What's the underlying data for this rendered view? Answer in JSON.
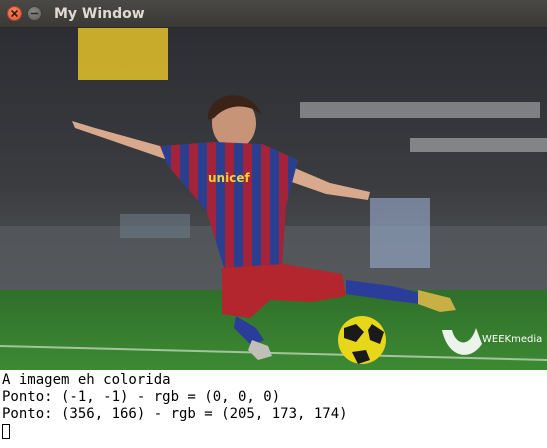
{
  "window": {
    "title": "My Window"
  },
  "image": {
    "watermark_text": "WEEKmedia",
    "shirt_text": "unicef"
  },
  "terminal": {
    "lines": [
      "A imagem eh colorida",
      "Ponto: (-1, -1) - rgb = (0, 0, 0)",
      "Ponto: (356, 166) - rgb = (205, 173, 174)"
    ]
  }
}
